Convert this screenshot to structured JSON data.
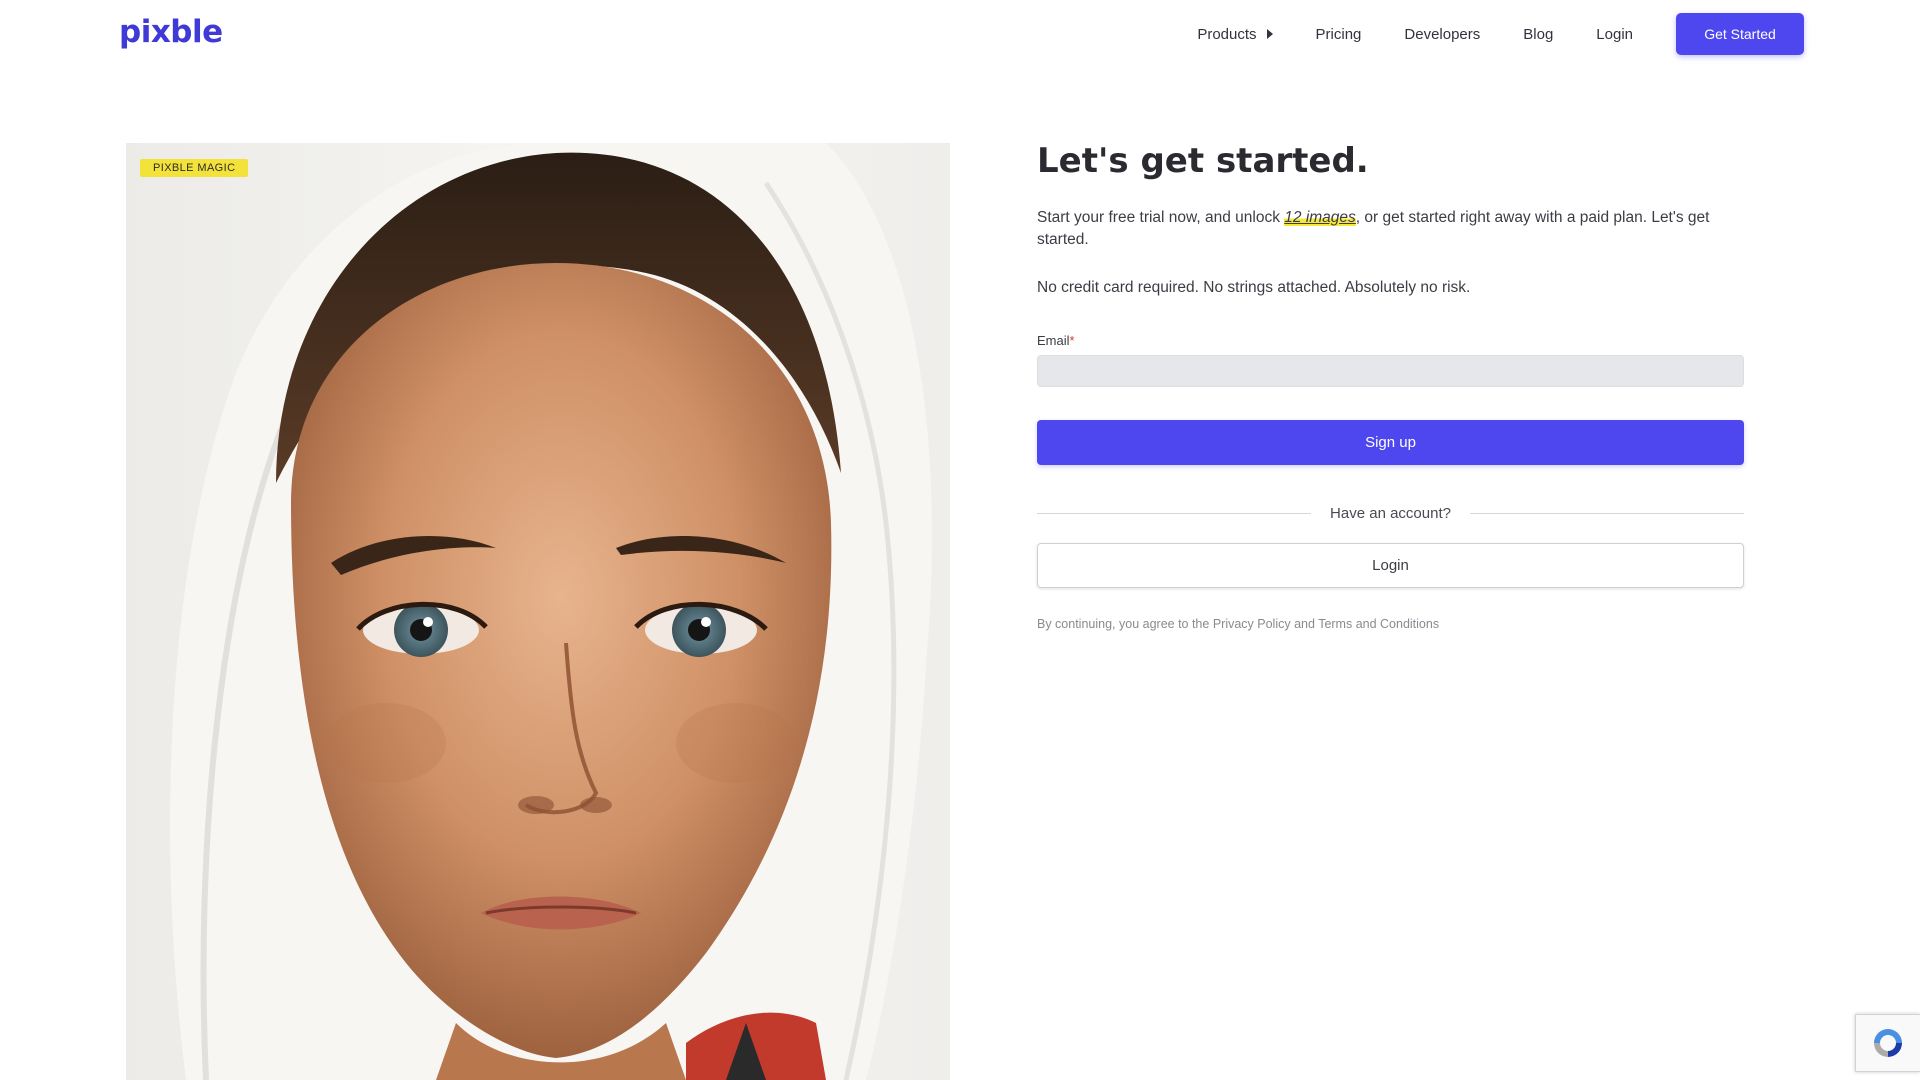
{
  "nav": {
    "logo": "pixble",
    "links": [
      "Products",
      "Pricing",
      "Developers",
      "Blog",
      "Login"
    ],
    "cta_label": "Get Started"
  },
  "hero": {
    "badge": "PIXBLE MAGIC"
  },
  "form": {
    "title": "Let's get started.",
    "intro_before": "Start your free trial now, and unlock ",
    "intro_highlight": "12 images",
    "intro_after": ", or get started right away with a paid plan. Let's get started.",
    "no_risk": "No credit card required. No strings attached. Absolutely no risk.",
    "email_label": "Email",
    "email_required_mark": "*",
    "email_value": "",
    "email_placeholder": "",
    "signup_label": "Sign up",
    "divider_text": "Have an account?",
    "login_label": "Login",
    "legal_prefix": "By continuing, you agree to the ",
    "privacy_link": "Privacy Policy",
    "legal_and": " and ",
    "terms_link": "Terms and Conditions"
  },
  "colors": {
    "brand": "#3f3ad6",
    "button": "#4e46ee",
    "badge": "#f3e23a",
    "highlight": "#f6e83a"
  },
  "icons": {
    "products_caret": "caret-right-icon",
    "recaptcha": "recaptcha-icon"
  }
}
